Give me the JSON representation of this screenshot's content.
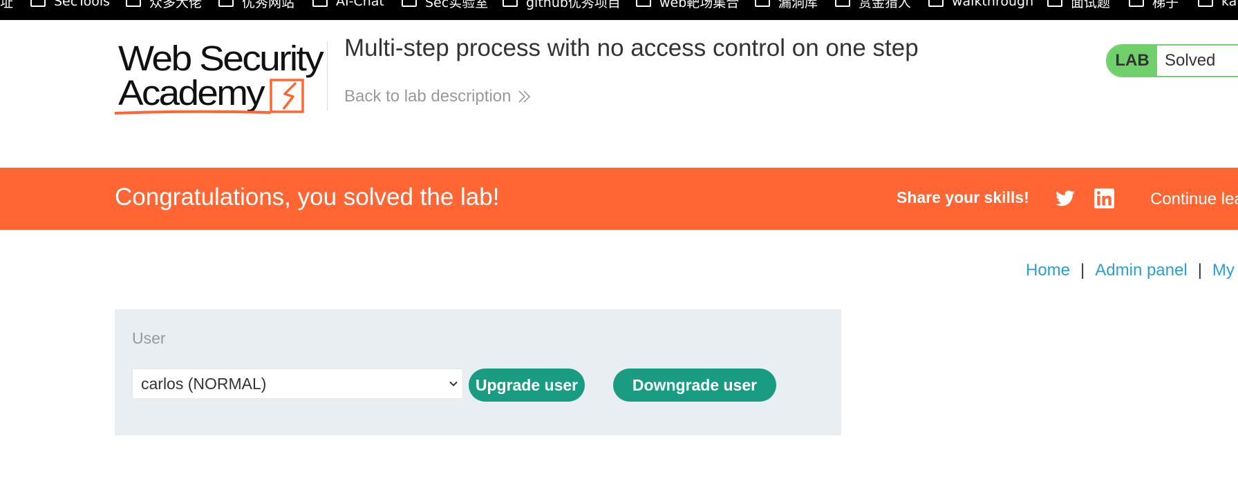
{
  "bookmarks": [
    "址",
    "SecTools",
    "众多大佬",
    "优秀网站",
    "AI-Chat",
    "Sec实验室",
    "github优秀项目",
    "web靶场集合",
    "漏洞库",
    "赏金猎人",
    "walkthrough",
    "面试题",
    "梯子",
    "ka"
  ],
  "header": {
    "logo_text": "Web Security Academy",
    "title": "Multi-step process with no access control on one step",
    "back_link": "Back to lab description",
    "lab_badge": {
      "label": "LAB",
      "status": "Solved"
    }
  },
  "banner": {
    "message": "Congratulations, you solved the lab!",
    "share": "Share your skills!",
    "continue": "Continue lea"
  },
  "nav": {
    "home": "Home",
    "admin": "Admin panel",
    "my_account": "My",
    "separator": "|"
  },
  "form": {
    "label": "User",
    "selected_user": "carlos (NORMAL)",
    "upgrade_button": "Upgrade user",
    "downgrade_button": "Downgrade user"
  },
  "colors": {
    "banner": "#ff6633",
    "lab_green": "#70d16c",
    "button": "#1a9c82",
    "link": "#2a9fd6",
    "panel": "#e8eef1"
  }
}
